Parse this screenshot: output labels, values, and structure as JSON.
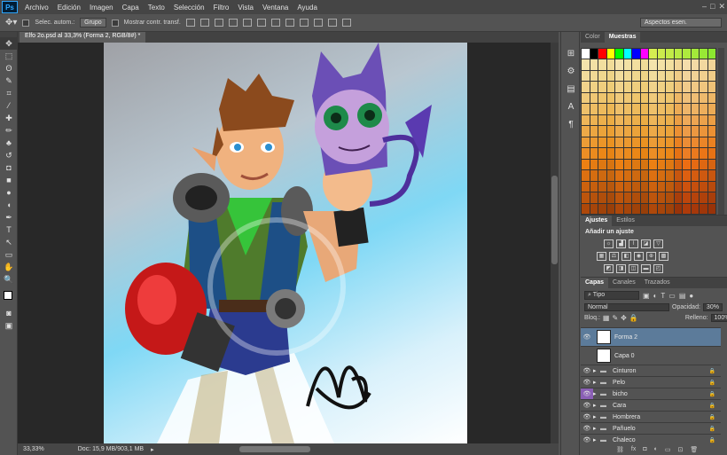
{
  "app": {
    "logo": "Ps"
  },
  "menu": [
    "Archivo",
    "Edición",
    "Imagen",
    "Capa",
    "Texto",
    "Selección",
    "Filtro",
    "Vista",
    "Ventana",
    "Ayuda"
  ],
  "window_controls": {
    "minimize": "–",
    "maximize": "□",
    "close": "✕"
  },
  "options": {
    "auto_select_label": "Selec. autom.:",
    "auto_select_value": "Grupo",
    "show_transform_label": "Mostrar contr. transf.",
    "workspace": "Aspectos esen."
  },
  "document": {
    "tab_title": "Elfo 2o.psd al 33,3% (Forma 2, RGB/8#) *",
    "zoom": "33,33%",
    "doc_info": "Doc: 15,9 MB/903,1 MB"
  },
  "tools": [
    "move-tool",
    "marquee-tool",
    "lasso-tool",
    "quick-select-tool",
    "crop-tool",
    "eyedropper-tool",
    "healing-tool",
    "brush-tool",
    "stamp-tool",
    "history-brush-tool",
    "eraser-tool",
    "gradient-tool",
    "blur-tool",
    "dodge-tool",
    "pen-tool",
    "type-tool",
    "path-select-tool",
    "shape-tool",
    "hand-tool",
    "zoom-tool"
  ],
  "tool_glyphs": [
    "✥",
    "⬚",
    "ʘ",
    "✎",
    "⌗",
    "⁄",
    "✚",
    "✏",
    "♣",
    "↺",
    "◘",
    "■",
    "●",
    "◖",
    "✒",
    "T",
    "↖",
    "▭",
    "✋",
    "🔍"
  ],
  "swatches_panel": {
    "tabs": [
      "Color",
      "Muestras"
    ],
    "active": "Muestras"
  },
  "adjustments_panel": {
    "tabs": [
      "Ajustes",
      "Estilos"
    ],
    "title": "Añadir un ajuste"
  },
  "layers_panel": {
    "tabs": [
      "Capas",
      "Canales",
      "Trazados"
    ],
    "filter": "Tipo",
    "blend_mode": "Normal",
    "opacity_label": "Opacidad:",
    "opacity_value": "30%",
    "lock_label": "Bloq.:",
    "fill_label": "Relleno:",
    "fill_value": "100%",
    "layers": [
      {
        "name": "Forma 2",
        "type": "shape",
        "visible": true,
        "selected": true
      },
      {
        "name": "Capa 0",
        "type": "pixel",
        "visible": false
      },
      {
        "name": "Cinturon",
        "type": "group",
        "visible": true
      },
      {
        "name": "Pelo",
        "type": "group",
        "visible": true
      },
      {
        "name": "bicho",
        "type": "group",
        "visible": true,
        "color_tag": "#8a5fb5"
      },
      {
        "name": "Cara",
        "type": "group",
        "visible": true
      },
      {
        "name": "Hombrera",
        "type": "group",
        "visible": true
      },
      {
        "name": "Pañuelo",
        "type": "group",
        "visible": true
      },
      {
        "name": "Chaleco",
        "type": "group",
        "visible": true
      }
    ]
  },
  "colors": {
    "accent": "#31a8ff",
    "selection": "#5c7b9a"
  }
}
